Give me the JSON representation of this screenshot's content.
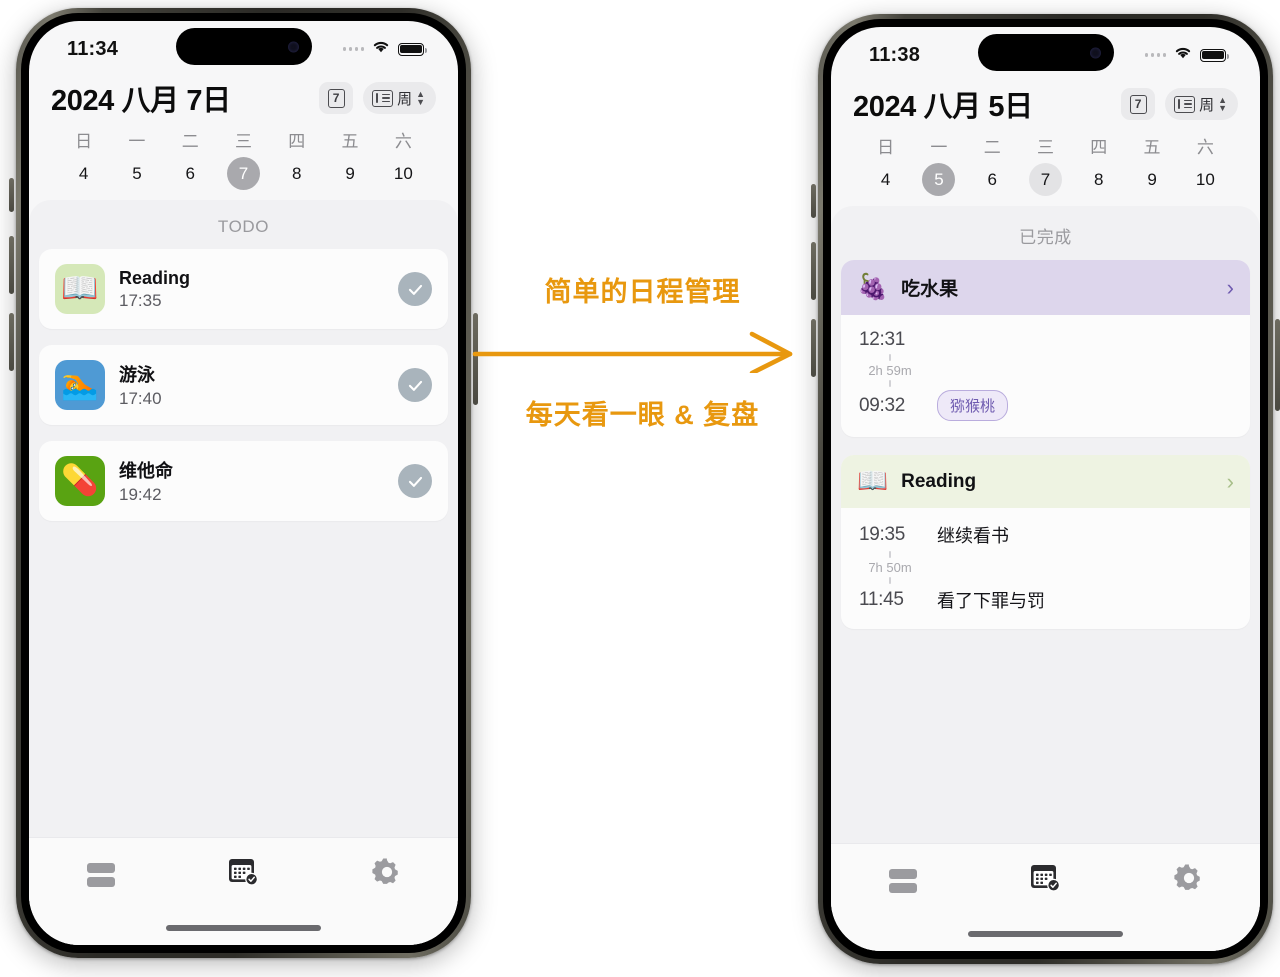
{
  "left_phone": {
    "status_bar": {
      "time": "11:34",
      "signal_icon": "signal-dots-icon",
      "wifi_icon": "wifi-icon",
      "battery_icon": "battery-full-icon"
    },
    "header": {
      "title": "2024 八月 7日",
      "day_chip_label": "7",
      "view_chip_label": "周",
      "day_chip_icon": "calendar-day-icon",
      "view_chip_icon": "list-view-icon",
      "chevron_icon": "chevron-up-down-icon"
    },
    "week_strip": [
      {
        "name": "日",
        "num": "4",
        "state": ""
      },
      {
        "name": "一",
        "num": "5",
        "state": ""
      },
      {
        "name": "二",
        "num": "6",
        "state": ""
      },
      {
        "name": "三",
        "num": "7",
        "state": "selected"
      },
      {
        "name": "四",
        "num": "8",
        "state": ""
      },
      {
        "name": "五",
        "num": "9",
        "state": ""
      },
      {
        "name": "六",
        "num": "10",
        "state": ""
      }
    ],
    "section_label": "TODO",
    "todos": [
      {
        "emoji": "📖",
        "emoji_name": "open-book-emoji",
        "emoji_bg": "#d5e8b8",
        "title": "Reading",
        "time": "17:35",
        "check_icon": "check-circle-icon"
      },
      {
        "emoji": "🏊",
        "emoji_name": "swimmer-emoji",
        "emoji_bg": "#4f9ad4",
        "title": "游泳",
        "time": "17:40",
        "check_icon": "check-circle-icon"
      },
      {
        "emoji": "💊",
        "emoji_name": "pill-emoji",
        "emoji_bg": "#59a312",
        "title": "维他命",
        "time": "19:42",
        "check_icon": "check-circle-icon"
      }
    ],
    "tabs": [
      {
        "icon": "stacked-rows-icon",
        "active": false
      },
      {
        "icon": "calendar-check-icon",
        "active": true
      },
      {
        "icon": "gear-icon",
        "active": false
      }
    ]
  },
  "right_phone": {
    "status_bar": {
      "time": "11:38",
      "signal_icon": "signal-dots-icon",
      "wifi_icon": "wifi-icon",
      "battery_icon": "battery-full-icon"
    },
    "header": {
      "title": "2024 八月 5日",
      "day_chip_label": "7",
      "view_chip_label": "周",
      "day_chip_icon": "calendar-day-icon",
      "view_chip_icon": "list-view-icon",
      "chevron_icon": "chevron-up-down-icon"
    },
    "week_strip": [
      {
        "name": "日",
        "num": "4",
        "state": ""
      },
      {
        "name": "一",
        "num": "5",
        "state": "selected"
      },
      {
        "name": "二",
        "num": "6",
        "state": ""
      },
      {
        "name": "三",
        "num": "7",
        "state": "today"
      },
      {
        "name": "四",
        "num": "8",
        "state": ""
      },
      {
        "name": "五",
        "num": "9",
        "state": ""
      },
      {
        "name": "六",
        "num": "10",
        "state": ""
      }
    ],
    "section_label": "已完成",
    "done_cards": [
      {
        "emoji": "🍇",
        "emoji_name": "grapes-emoji",
        "title": "吃水果",
        "header_bg": "#ddd6ec",
        "chevron_color": "#6f5bb0",
        "chevron_icon": "chevron-right-icon",
        "end_time": "12:31",
        "duration": "2h 59m",
        "start_time": "09:32",
        "end_note": "",
        "start_note": "",
        "tag": "猕猴桃"
      },
      {
        "emoji": "📖",
        "emoji_name": "open-book-emoji",
        "title": "Reading",
        "header_bg": "#eef3e2",
        "chevron_color": "#a8bf8a",
        "chevron_icon": "chevron-right-icon",
        "end_time": "19:35",
        "duration": "7h 50m",
        "start_time": "11:45",
        "end_note": "继续看书",
        "start_note": "看了下罪与罚",
        "tag": ""
      }
    ],
    "tabs": [
      {
        "icon": "stacked-rows-icon",
        "active": false
      },
      {
        "icon": "calendar-check-icon",
        "active": true
      },
      {
        "icon": "gear-icon",
        "active": false
      }
    ]
  },
  "annotation": {
    "top_text": "简单的日程管理",
    "bottom_text": "每天看一眼 & 复盘",
    "arrow_icon": "right-arrow-icon",
    "color": "#e8980f"
  }
}
